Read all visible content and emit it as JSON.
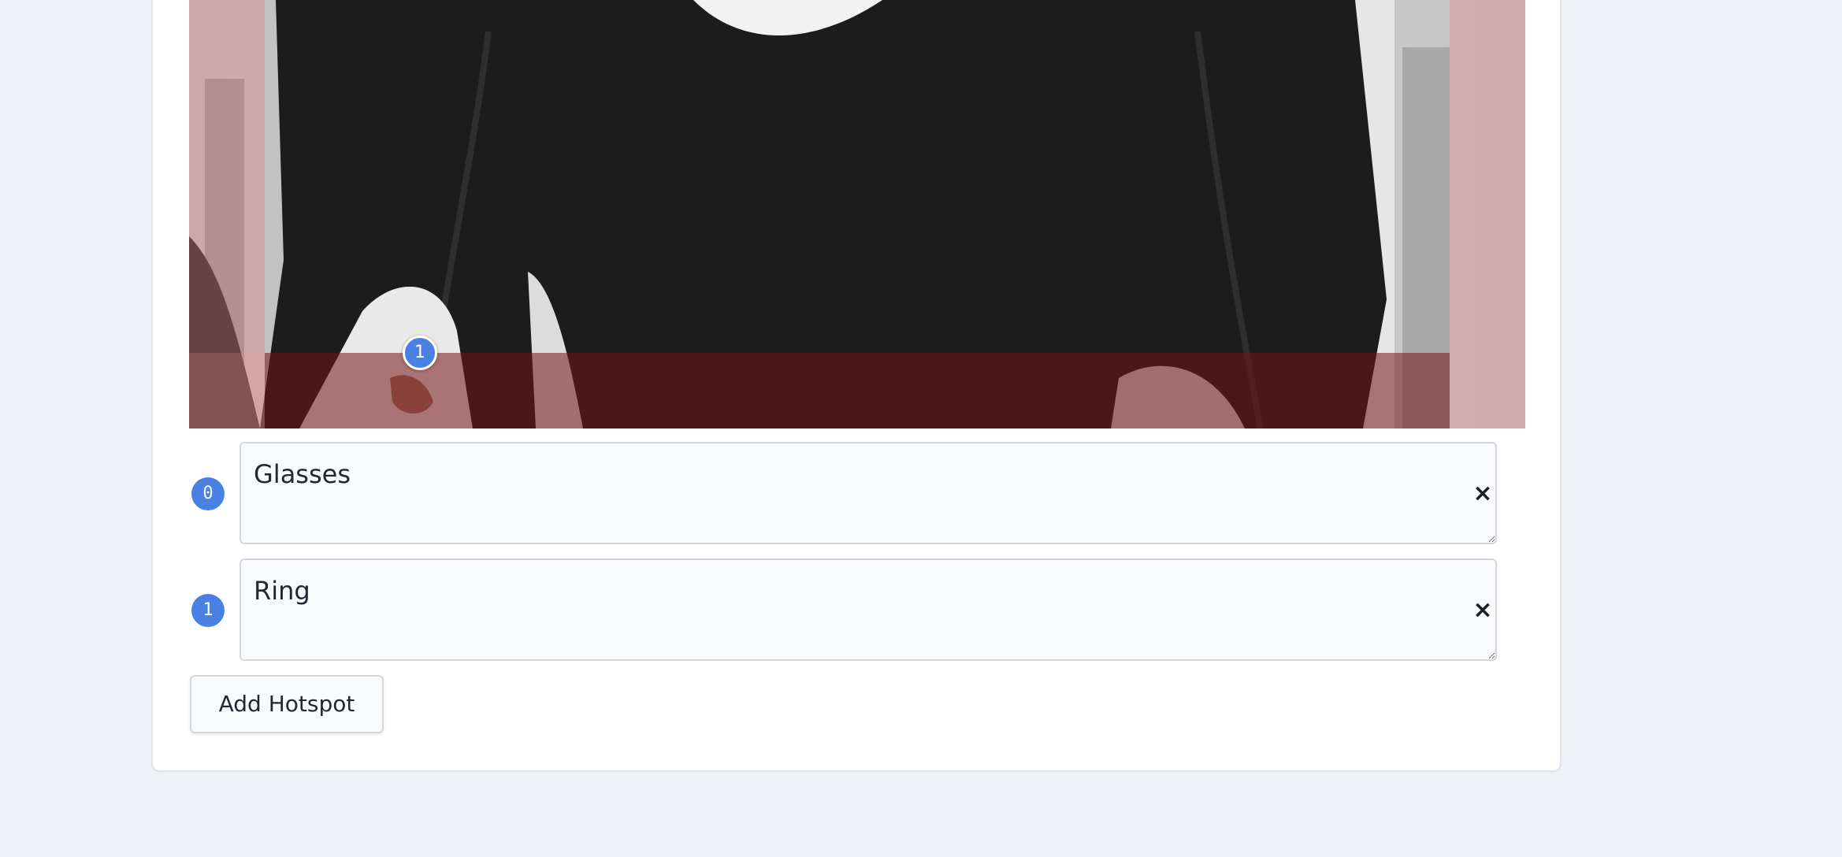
{
  "hotspot_markers": [
    {
      "label": "1"
    }
  ],
  "hotspots": [
    {
      "index": "0",
      "text": "Glasses"
    },
    {
      "index": "1",
      "text": "Ring"
    }
  ],
  "remove_icon": "×",
  "add_button_label": "Add Hotspot",
  "colors": {
    "page_background": "#eef1f5",
    "accent": "#4a7fe3",
    "mask_side": "#ec7878",
    "mask_bottom": "#781414"
  }
}
